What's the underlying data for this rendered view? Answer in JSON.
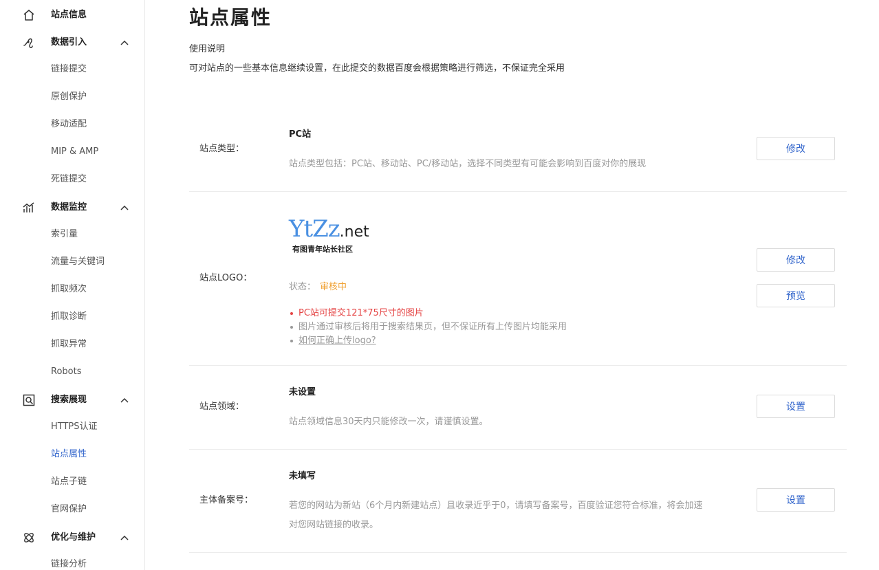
{
  "sidebar": {
    "groups": [
      {
        "label": "站点信息",
        "icon": "home-icon",
        "items": []
      },
      {
        "label": "数据引入",
        "icon": "data-import-icon",
        "items": [
          "链接提交",
          "原创保护",
          "移动适配",
          "MIP & AMP",
          "死链提交"
        ]
      },
      {
        "label": "数据监控",
        "icon": "monitor-chart-icon",
        "items": [
          "索引量",
          "流量与关键词",
          "抓取频次",
          "抓取诊断",
          "抓取异常",
          "Robots"
        ]
      },
      {
        "label": "搜索展现",
        "icon": "search-display-icon",
        "items": [
          "HTTPS认证",
          "站点属性",
          "站点子链",
          "官网保护"
        ]
      },
      {
        "label": "优化与维护",
        "icon": "optimize-atom-icon",
        "items": [
          "链接分析"
        ]
      }
    ],
    "active_item": "站点属性"
  },
  "main": {
    "title": "站点属性",
    "usage_title": "使用说明",
    "usage_desc": "可对站点的一些基本信息继续设置，在此提交的数据百度会根据策略进行筛选，不保证完全采用",
    "rows": {
      "site_type": {
        "label": "站点类型：",
        "value": "PC站",
        "desc": "站点类型包括：PC站、移动站、PC/移动站，选择不同类型有可能会影响到百度对你的展现",
        "button": "修改"
      },
      "logo": {
        "label": "站点LOGO：",
        "logo_text_main": "YtZz",
        "logo_text_suffix": ".net",
        "logo_caption": "有图青年站长社区",
        "status_label": "状态：",
        "status_value": "审核中",
        "notes": [
          "PC站可提交121*75尺寸的图片",
          "图片通过审核后将用于搜索结果页，但不保证所有上传图片均能采用",
          "如何正确上传logo?"
        ],
        "button_edit": "修改",
        "button_preview": "预览"
      },
      "domain": {
        "label": "站点领域：",
        "value": "未设置",
        "desc": "站点领域信息30天内只能修改一次，请谨慎设置。",
        "button": "设置"
      },
      "icp": {
        "label": "主体备案号：",
        "value": "未填写",
        "desc_line1": "若您的网站为新站（6个月内新建站点）且收录近乎于0，请填写备案号，百度验证您符合标准，将会加速",
        "desc_line2": "对您网站链接的收录。",
        "button": "设置"
      }
    }
  },
  "colors": {
    "accent": "#3366cc",
    "status_pending": "#f0a030",
    "warning": "#e54545",
    "muted": "#999999",
    "logo_blue": "#4a90e2"
  }
}
